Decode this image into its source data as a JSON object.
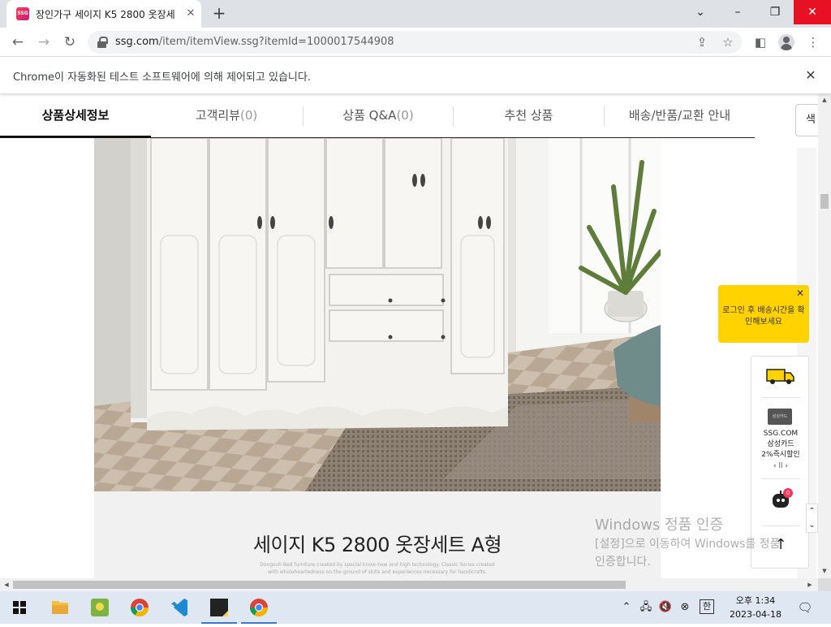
{
  "browser": {
    "tab_title": "장인가구 세이지 K5 2800 옷장세",
    "favicon_text": "SSG",
    "url_host": "ssg.com",
    "url_path": "/item/itemView.ssg?itemId=1000017544908",
    "infobar_text": "Chrome이 자동화된 테스트 소프트웨어에 의해 제어되고 있습니다."
  },
  "page": {
    "tabs": [
      {
        "label": "상품상세정보",
        "count": ""
      },
      {
        "label": "고객리뷰",
        "count": "(0)"
      },
      {
        "label": "상품 Q&A",
        "count": "(0)"
      },
      {
        "label": "추천 상품",
        "count": ""
      },
      {
        "label": "배송/반품/교환 안내",
        "count": ""
      }
    ],
    "color_button": "색",
    "product_name": "세이지 K5 2800 옷장세트 A형",
    "product_desc_line1": "Dongsuh Bed furniture created by special know-how and high technology. Classic Series created",
    "product_desc_line2": "with wholeheartedness on the ground of skills and experiences necessary for handicrafts."
  },
  "side": {
    "login_tip": "로그인 후 배송시간을 확인해보세요",
    "card_label_small": "삼성카드",
    "card_text_line1": "SSG.COM",
    "card_text_line2": "삼성카드",
    "card_text_line3": "2%즉시할인",
    "card_nav": "‹ ll ›",
    "bot_badge": "0"
  },
  "watermark": {
    "title": "Windows 정품 인증",
    "line1": "[설정]으로 이동하여 Windows를 정품",
    "line2": "인증합니다."
  },
  "taskbar": {
    "time": "오후 1:34",
    "date": "2023-04-18",
    "ime": "한"
  },
  "colors": {
    "accent_tip": "#ffd200",
    "close_red": "#e81123",
    "badge_red": "#ff3355"
  }
}
